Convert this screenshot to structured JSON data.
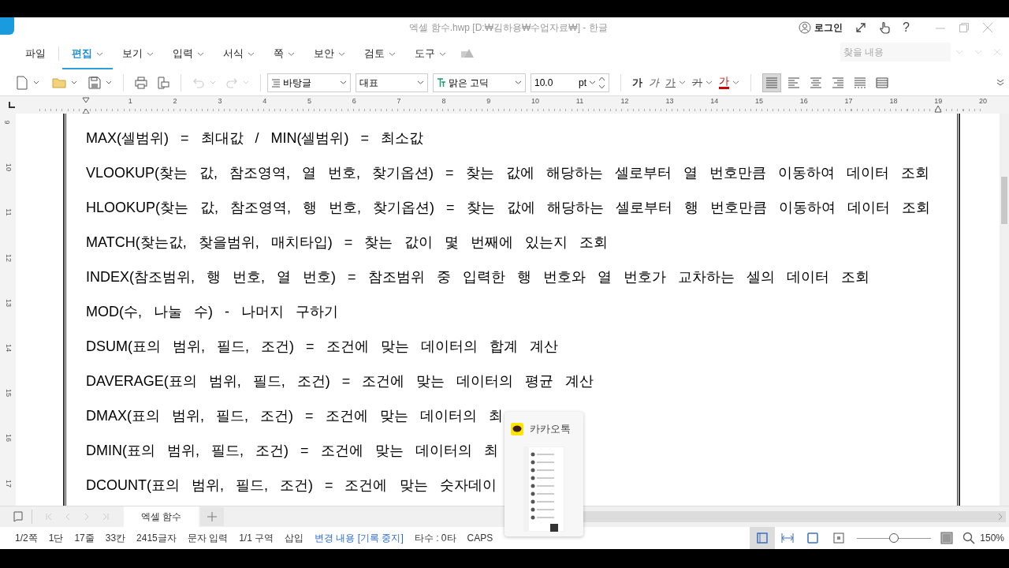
{
  "window": {
    "title": "엑셀 함수.hwp [D:₩김하용₩수업자료₩] - 한글",
    "login": "로그인",
    "help": "?"
  },
  "menu": [
    {
      "label": "파일",
      "selected": false,
      "dropdown": false
    },
    {
      "label": "편집",
      "selected": true,
      "dropdown": true
    },
    {
      "label": "보기",
      "selected": false,
      "dropdown": true
    },
    {
      "label": "입력",
      "selected": false,
      "dropdown": true
    },
    {
      "label": "서식",
      "selected": false,
      "dropdown": true
    },
    {
      "label": "쪽",
      "selected": false,
      "dropdown": true
    },
    {
      "label": "보안",
      "selected": false,
      "dropdown": true
    },
    {
      "label": "검토",
      "selected": false,
      "dropdown": true
    },
    {
      "label": "도구",
      "selected": false,
      "dropdown": true
    }
  ],
  "find": {
    "placeholder": "찾을 내용"
  },
  "toolbar": {
    "style": "바탕글",
    "language": "대표",
    "font": "맑은 고딕",
    "size": "10.0",
    "unit": "pt",
    "char_buttons": [
      {
        "label": "가",
        "kind": "bold"
      },
      {
        "label": "가",
        "kind": "italic"
      },
      {
        "label": "가",
        "kind": "underline"
      },
      {
        "label": "가",
        "kind": "strike"
      },
      {
        "label": "가",
        "kind": "color"
      }
    ],
    "alignments": [
      {
        "kind": "justify",
        "selected": true
      },
      {
        "kind": "left",
        "selected": false
      },
      {
        "kind": "center",
        "selected": false
      },
      {
        "kind": "right",
        "selected": false
      },
      {
        "kind": "distribute",
        "selected": false
      },
      {
        "kind": "divide",
        "selected": false
      }
    ]
  },
  "ruler": {
    "marks": [
      "1",
      "2",
      "3",
      "4",
      "5",
      "6",
      "7",
      "8",
      "9",
      "10",
      "11",
      "12",
      "13",
      "14",
      "15",
      "16",
      "17",
      "18",
      "19",
      "20"
    ]
  },
  "vertical_ruler": {
    "marks": [
      "9",
      "10",
      "11",
      "12",
      "13",
      "14",
      "15",
      "16",
      "17"
    ]
  },
  "document": {
    "lines": [
      "MAX(셀범위) = 최대값 / MIN(셀범위) = 최소값",
      "VLOOKUP(찾는 값, 참조영역, 열 번호, 찾기옵션) = 찾는 값에 해당하는 셀로부터 열 번호만큼 이동하여 데이터 조회",
      "HLOOKUP(찾는 값, 참조영역, 행 번호, 찾기옵션) = 찾는 값에 해당하는 셀로부터 행 번호만큼 이동하여 데이터 조회",
      "MATCH(찾는값, 찾을범위, 매치타입) = 찾는 값이 몇 번째에 있는지 조회",
      "INDEX(참조범위, 행 번호, 열 번호) = 참조범위 중 입력한 행 번호와 열 번호가 교차하는 셀의 데이터 조회",
      "MOD(수, 나눌 수) - 나머지 구하기",
      "DSUM(표의 범위, 필드, 조건) = 조건에 맞는 데이터의 합계 계산",
      "DAVERAGE(표의 범위, 필드, 조건) = 조건에 맞는 데이터의 평균 계산",
      "DMAX(표의 범위, 필드, 조건) = 조건에 맞는 데이터의 최",
      "DMIN(표의 범위, 필드, 조건) = 조건에 맞는 데이터의 최",
      "DCOUNT(표의 범위, 필드, 조건) = 조건에 맞는 숫자데이"
    ]
  },
  "doc_tabs": [
    {
      "label": "엑셀 함수",
      "selected": true
    }
  ],
  "status_bar": {
    "items": [
      {
        "text": "1/2쪽",
        "kind": "plain"
      },
      {
        "text": "1단",
        "kind": "plain"
      },
      {
        "text": "17줄",
        "kind": "plain"
      },
      {
        "text": "33칸",
        "kind": "plain"
      },
      {
        "text": "2415글자",
        "kind": "plain"
      },
      {
        "text": "문자 입력",
        "kind": "plain"
      },
      {
        "text": "1/1 구역",
        "kind": "plain"
      },
      {
        "text": "삽입",
        "kind": "plain"
      },
      {
        "text": "변경 내용 [기록 중지]",
        "kind": "link"
      },
      {
        "text": "타수 : 0타",
        "kind": "plain"
      },
      {
        "text": "CAPS",
        "kind": "plain"
      }
    ],
    "view_buttons": [
      {
        "selected": true
      },
      {
        "selected": false
      },
      {
        "selected": false
      }
    ],
    "zoom": {
      "level": 0.5,
      "reading": "150%"
    }
  },
  "popup": {
    "title": "카카오톡"
  }
}
